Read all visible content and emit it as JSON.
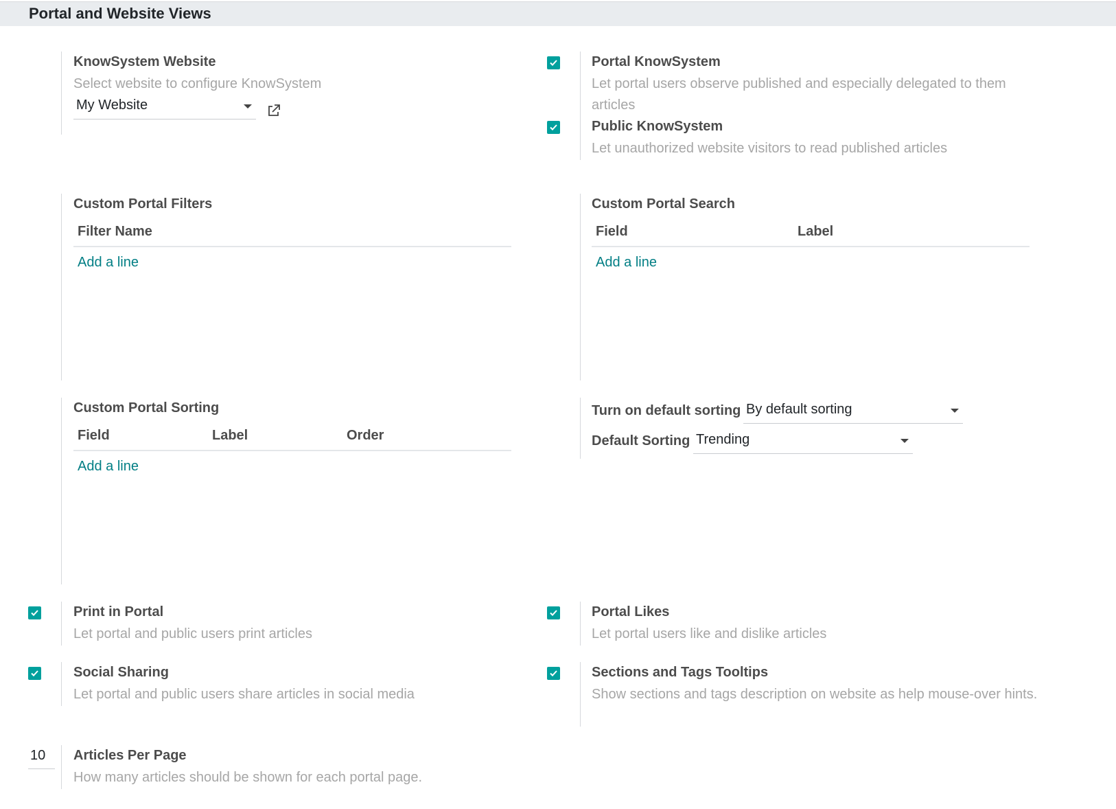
{
  "section": {
    "title": "Portal and Website Views"
  },
  "knowsystem_website": {
    "label": "KnowSystem Website",
    "help": "Select website to configure KnowSystem",
    "value": "My Website"
  },
  "portal_knowsystem": {
    "label": "Portal KnowSystem",
    "help": "Let portal users observe published and especially delegated to them articles",
    "checked": true
  },
  "public_knowsystem": {
    "label": "Public KnowSystem",
    "help": "Let unauthorized website visitors to read published articles",
    "checked": true
  },
  "custom_portal_filters": {
    "label": "Custom Portal Filters",
    "columns": [
      "Filter Name"
    ],
    "add_line": "Add a line"
  },
  "custom_portal_search": {
    "label": "Custom Portal Search",
    "columns": [
      "Field",
      "Label"
    ],
    "add_line": "Add a line"
  },
  "custom_portal_sorting": {
    "label": "Custom Portal Sorting",
    "columns": [
      "Field",
      "Label",
      "Order"
    ],
    "add_line": "Add a line"
  },
  "default_sorting": {
    "turn_on_label": "Turn on default sorting",
    "turn_on_value": "By default sorting",
    "sorting_label": "Default Sorting",
    "sorting_value": "Trending"
  },
  "print_in_portal": {
    "label": "Print in Portal",
    "help": "Let portal and public users print articles",
    "checked": true
  },
  "portal_likes": {
    "label": "Portal Likes",
    "help": "Let portal users like and dislike articles",
    "checked": true
  },
  "social_sharing": {
    "label": "Social Sharing",
    "help": "Let portal and public users share articles in social media",
    "checked": true
  },
  "sections_tags_tooltips": {
    "label": "Sections and Tags Tooltips",
    "help": "Show sections and tags description on website as help mouse-over hints.",
    "checked": true
  },
  "articles_per_page": {
    "label": "Articles Per Page",
    "help": "How many articles should be shown for each portal page.",
    "value": "10"
  },
  "colors": {
    "accent": "#00a09d",
    "link": "#017e84"
  }
}
